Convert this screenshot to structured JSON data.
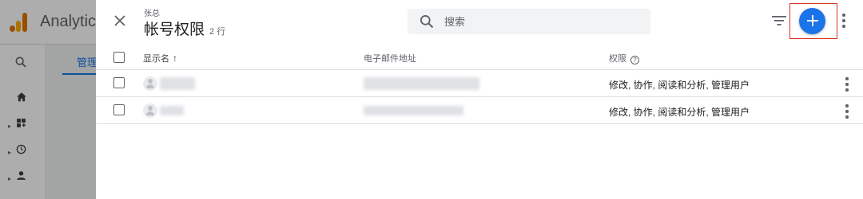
{
  "background": {
    "app_title": "Analytics",
    "tab_label": "管理"
  },
  "header": {
    "breadcrumb": "张总",
    "title": "帐号权限",
    "row_count": "2 行",
    "search_placeholder": "搜索"
  },
  "table": {
    "columns": [
      "显示名",
      "电子邮件地址",
      "权限"
    ],
    "sort_indicator": "↑",
    "rows": [
      {
        "permissions": "修改, 协作, 阅读和分析, 管理用户"
      },
      {
        "permissions": "修改, 协作, 阅读和分析, 管理用户"
      }
    ]
  },
  "colors": {
    "accent": "#1a73e8",
    "highlight_border": "#d93025"
  },
  "icons": [
    "close-icon",
    "search-icon",
    "filter-icon",
    "add-icon",
    "more-vert-icon",
    "help-icon",
    "avatar-icon"
  ]
}
